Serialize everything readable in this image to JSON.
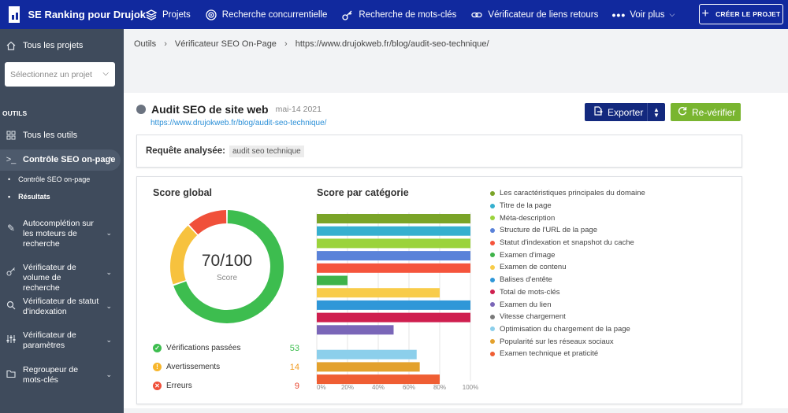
{
  "app": {
    "title": "SE Ranking pour Drujok"
  },
  "topnav": {
    "items": [
      {
        "label": "Projets",
        "icon": "layers-icon"
      },
      {
        "label": "Recherche concurrentielle",
        "icon": "target-icon"
      },
      {
        "label": "Recherche de mots-clés",
        "icon": "key-icon"
      },
      {
        "label": "Vérificateur de liens retours",
        "icon": "link-icon"
      },
      {
        "label": "Voir plus",
        "icon": "more-icon"
      }
    ],
    "create_label": "CRÉER LE PROJET"
  },
  "sidebar": {
    "all_projects": "Tous les projets",
    "project_placeholder": "Sélectionnez un projet",
    "section": "OUTILS",
    "all_tools": "Tous les outils",
    "active_tool": "Contrôle SEO on-page",
    "sub_items": [
      "Contrôle SEO on-page",
      "Résultats"
    ],
    "tools": [
      "Autocomplétion sur les moteurs de recherche",
      "Vérificateur de volume de recherche",
      "Vérificateur de statut d'indexation",
      "Vérificateur de paramètres",
      "Regroupeur de mots-clés"
    ]
  },
  "breadcrumb": [
    "Outils",
    "Vérificateur SEO On-Page",
    "https://www.drujokweb.fr/blog/audit-seo-technique/"
  ],
  "page": {
    "title": "Audit SEO de site web",
    "date": "mai-14 2021",
    "url": "https://www.drujokweb.fr/blog/audit-seo-technique/",
    "export_label": "Exporter",
    "recheck_label": "Re-vérifier"
  },
  "query": {
    "label": "Requête analysée:",
    "value": "audit seo technique"
  },
  "score": {
    "heading": "Score global",
    "value": "70/100",
    "label": "Score",
    "passed_label": "Vérifications passées",
    "passed": "53",
    "warnings_label": "Avertissements",
    "warnings": "14",
    "errors_label": "Erreurs",
    "errors": "9",
    "colors": {
      "passed": "#3dbd4f",
      "warnings": "#f7c23e",
      "errors": "#f0503a"
    }
  },
  "category": {
    "heading": "Score par catégorie"
  },
  "chart_data": {
    "type": "bar",
    "orientation": "horizontal",
    "categories": [
      "Les caractéristiques principales du domaine",
      "Titre de la page",
      "Méta-description",
      "Structure de l'URL de la page",
      "Statut d'indexation et snapshot du cache",
      "Examen d'image",
      "Examen de contenu",
      "Balises d'entête",
      "Total de mots-clés",
      "Examen du lien",
      "Vitesse chargement",
      "Optimisation du chargement de la page",
      "Popularité sur les réseaux sociaux",
      "Examen technique et praticité"
    ],
    "values": [
      100,
      100,
      100,
      100,
      100,
      20,
      80,
      100,
      100,
      50,
      0,
      65,
      67,
      80
    ],
    "colors": [
      "#7aa428",
      "#35b0cf",
      "#9bd33c",
      "#5a82d9",
      "#f5543c",
      "#3fb34a",
      "#f8cc4a",
      "#2f97d8",
      "#cf1f4f",
      "#7a66b8",
      "#7a7a7a",
      "#8ccfeb",
      "#e3a12d",
      "#ef5e33"
    ],
    "xlim": [
      0,
      100
    ],
    "ticks": [
      "0%",
      "20%",
      "40%",
      "60%",
      "80%",
      "100%"
    ],
    "legend_position": "right"
  }
}
